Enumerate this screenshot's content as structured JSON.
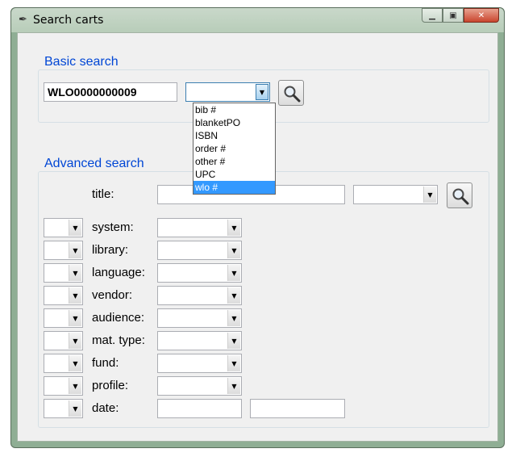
{
  "window": {
    "title": "Search carts",
    "app_icon": "feather-icon"
  },
  "basic": {
    "legend": "Basic search",
    "query_value": "WLO0000000009",
    "field_value": "",
    "field_options": [
      "bib #",
      "blanketPO",
      "ISBN",
      "order #",
      "other #",
      "UPC",
      "wlo #"
    ],
    "highlighted_option": "wlo #"
  },
  "advanced": {
    "legend": "Advanced search",
    "title_label": "title:",
    "rows": [
      {
        "label": "system:"
      },
      {
        "label": "library:"
      },
      {
        "label": "language:"
      },
      {
        "label": "vendor:"
      },
      {
        "label": "audience:"
      },
      {
        "label": "mat. type:"
      },
      {
        "label": "fund:"
      },
      {
        "label": "profile:"
      },
      {
        "label": "date:"
      }
    ]
  },
  "colors": {
    "legend": "#0046d5",
    "selection": "#3399ff",
    "frame": "#8fae94"
  }
}
